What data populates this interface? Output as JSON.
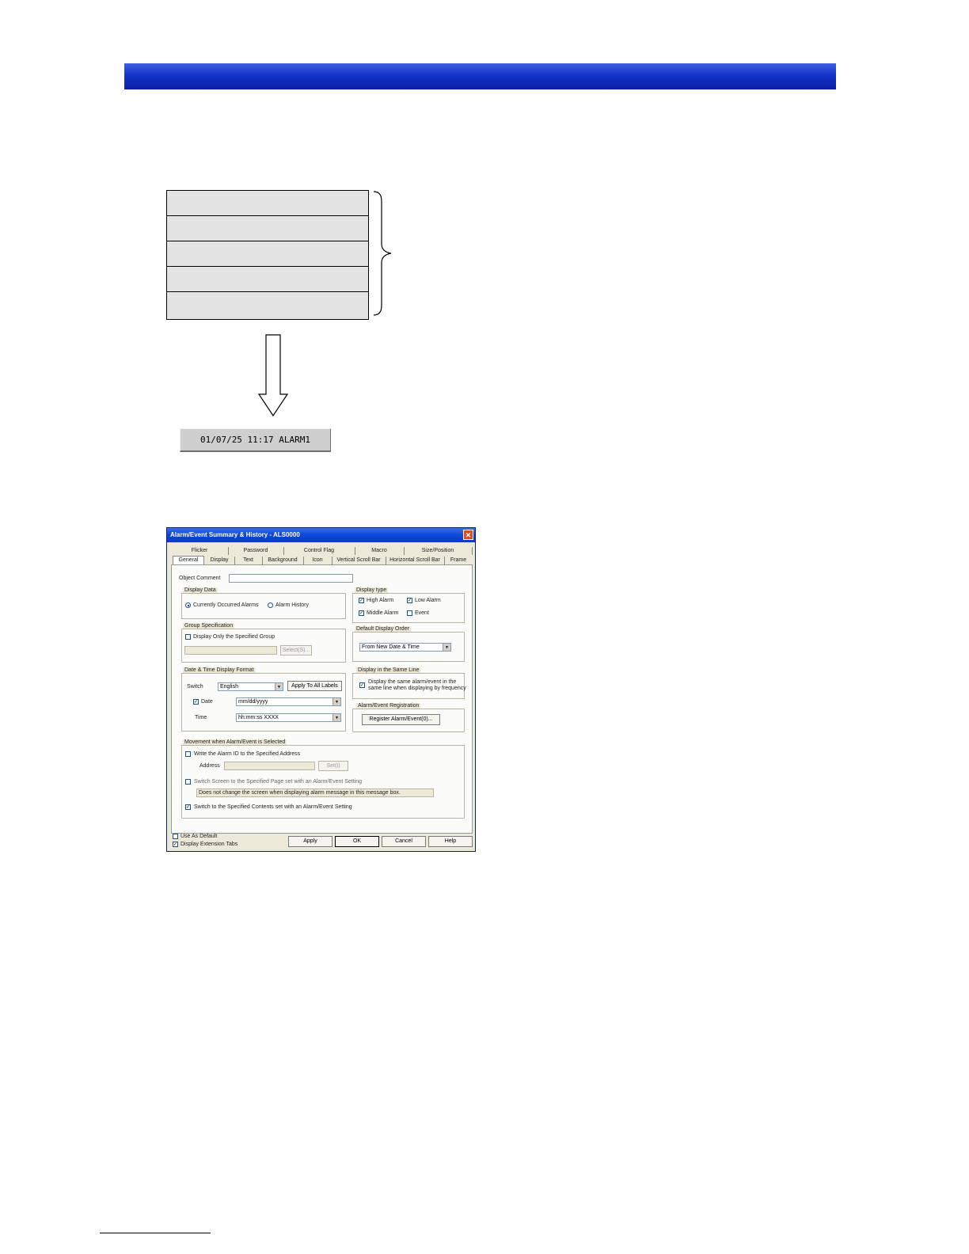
{
  "diagram": {
    "single_message": "01/07/25 11:17 ALARM1"
  },
  "dialog": {
    "title": "Alarm/Event Summary & History - ALS0000",
    "close_glyph": "✕",
    "tabs_top": [
      "Flicker",
      "Password",
      "Control Flag",
      "Macro",
      "Size/Position"
    ],
    "tabs_bottom": [
      "General",
      "Display",
      "Text",
      "Background",
      "Icon",
      "Vertical Scroll Bar",
      "Horizontal Scroll Bar",
      "Frame"
    ],
    "object_comment_label": "Object Comment",
    "display_data": {
      "label": "Display Data",
      "opt1": "Currently Occurred Alarms",
      "opt2": "Alarm History"
    },
    "display_type": {
      "label": "Display type",
      "high": "High Alarm",
      "low": "Low Alarm",
      "middle": "Middle Alarm",
      "event": "Event"
    },
    "group_spec": {
      "label": "Group Specification",
      "check": "Display Only the Specified Group",
      "select_btn": "Select(S)..."
    },
    "default_order": {
      "label": "Default Display Order",
      "value": "From New Date & Time"
    },
    "datetime": {
      "label": "Date & Time Display Format",
      "switch_label": "Switch",
      "switch_value": "English",
      "apply_all": "Apply To All Labels",
      "date_label": "Date",
      "date_value": "mm/dd/yyyy",
      "time_label": "Time",
      "time_value": "hh:mm:ss XXXX"
    },
    "same_line": {
      "label": "Display in the Same Line",
      "check_line1": "Display the same alarm/event in the",
      "check_line2": "same line when displaying by frequency"
    },
    "registration": {
      "label": "Alarm/Event Registration",
      "button": "Register Alarm/Event(0)..."
    },
    "movement": {
      "label": "Movement when Alarm/Event is Selected",
      "write_id": "Write the Alarm ID to the Specified Address",
      "address_label": "Address",
      "set_btn": "Set(I)",
      "switch_screen": "Switch Screen to the Specified Page set with an Alarm/Event Setting",
      "no_change": "Does not change the screen when displaying alarm message in this message box.",
      "switch_contents": "Switch to the Specified Contents set with an Alarm/Event Setting"
    },
    "footer": {
      "use_default": "Use As Default",
      "display_ext": "Display Extension Tabs",
      "apply": "Apply",
      "ok": "OK",
      "cancel": "Cancel",
      "help": "Help"
    },
    "check_glyph": "✓"
  }
}
